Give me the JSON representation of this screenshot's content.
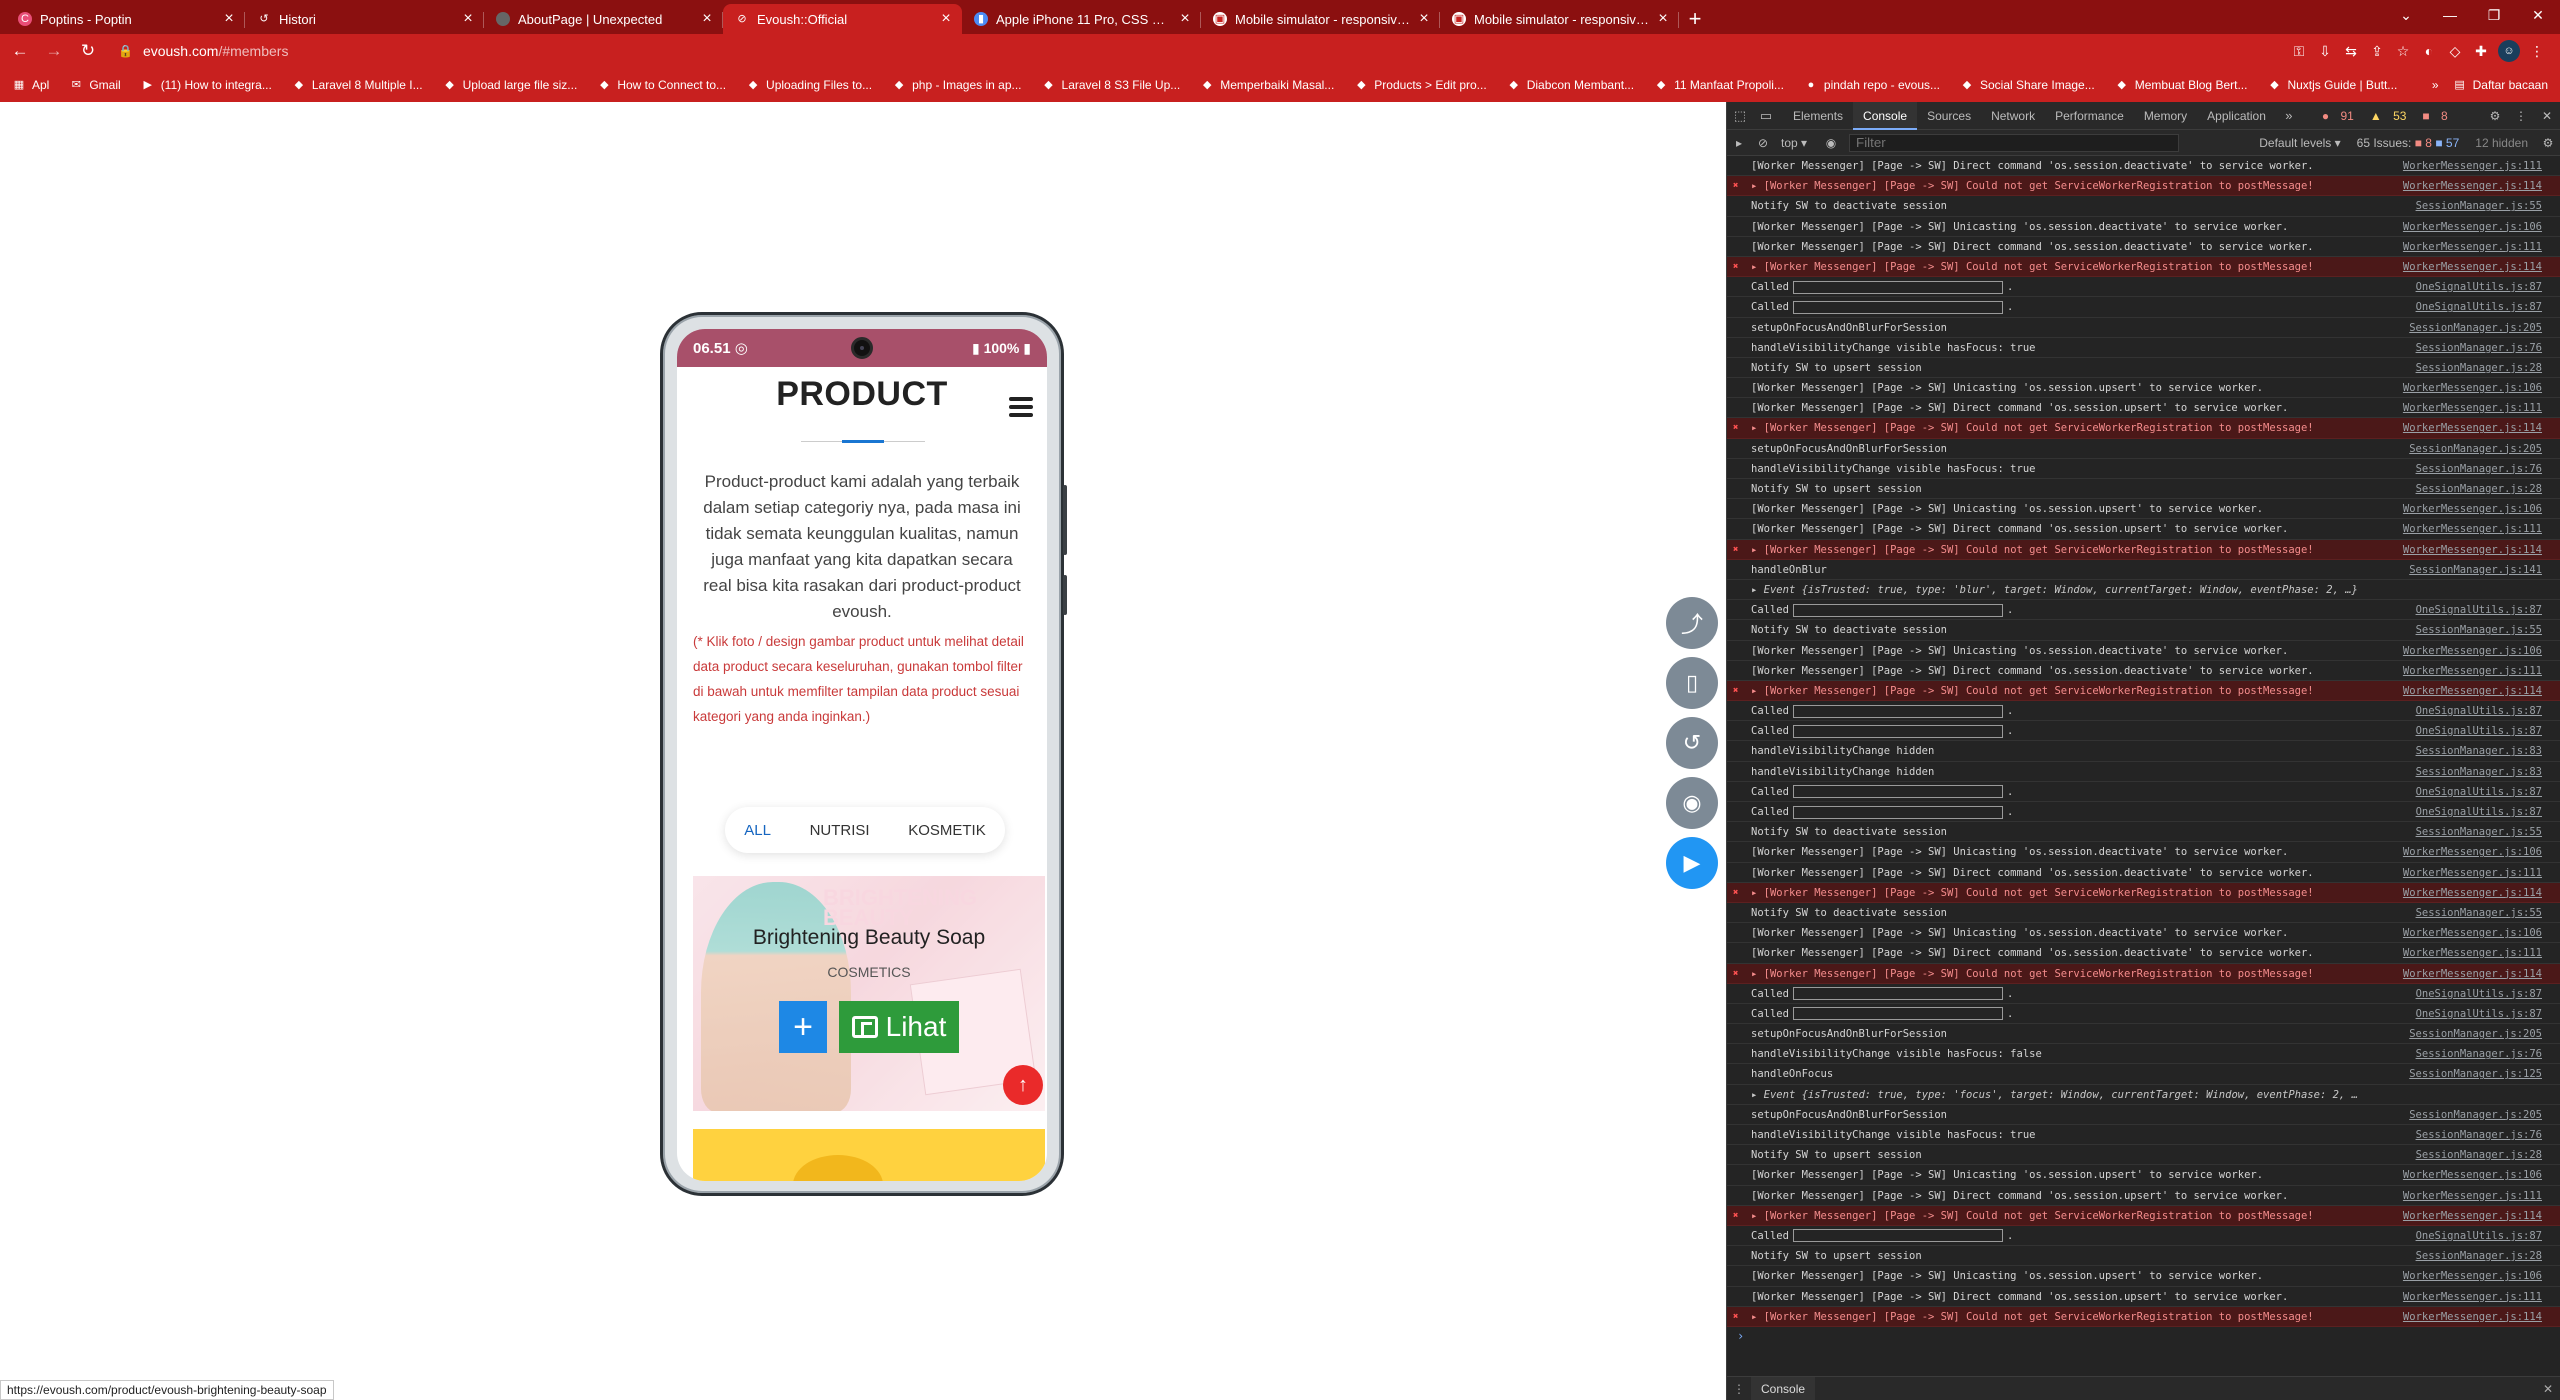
{
  "tabs": [
    {
      "title": "Poptins - Poptin",
      "icon": "poptin-favicon",
      "active": false
    },
    {
      "title": "Histori",
      "icon": "history-icon",
      "active": false
    },
    {
      "title": "AboutPage | Unexpected",
      "icon": "generic-favicon",
      "active": false
    },
    {
      "title": "Evoush::Official",
      "icon": "evoush-favicon",
      "active": true
    },
    {
      "title": "Apple iPhone 11 Pro, CSS viewport",
      "icon": "doc-favicon",
      "active": false
    },
    {
      "title": "Mobile simulator - responsive te",
      "icon": "simulator-favicon",
      "active": false
    },
    {
      "title": "Mobile simulator - responsive te",
      "icon": "simulator-favicon",
      "active": false
    }
  ],
  "address": {
    "domain": "evoush.com",
    "path": "/#members"
  },
  "bookmarks": [
    {
      "label": "Apl",
      "icon": "apps-icon"
    },
    {
      "label": "Gmail",
      "icon": "gmail-icon"
    },
    {
      "label": "(11) How to integra...",
      "icon": "youtube-icon"
    },
    {
      "label": "Laravel 8 Multiple I...",
      "icon": "site-icon"
    },
    {
      "label": "Upload large file siz...",
      "icon": "site-icon"
    },
    {
      "label": "How to Connect to...",
      "icon": "site-icon"
    },
    {
      "label": "Uploading Files to...",
      "icon": "site-icon"
    },
    {
      "label": "php - Images in ap...",
      "icon": "site-icon"
    },
    {
      "label": "Laravel 8 S3 File Up...",
      "icon": "site-icon"
    },
    {
      "label": "Memperbaiki Masal...",
      "icon": "site-icon"
    },
    {
      "label": "Products > Edit pro...",
      "icon": "site-icon"
    },
    {
      "label": "Diabcon Membant...",
      "icon": "site-icon"
    },
    {
      "label": "11 Manfaat Propoli...",
      "icon": "site-icon"
    },
    {
      "label": "pindah repo - evous...",
      "icon": "github-icon"
    },
    {
      "label": "Social Share Image...",
      "icon": "site-icon"
    },
    {
      "label": "Membuat Blog Bert...",
      "icon": "site-icon"
    },
    {
      "label": "Nuxtjs Guide | Butt...",
      "icon": "site-icon"
    }
  ],
  "bookmarks_more": "Daftar bacaan",
  "phone": {
    "time": "06.51",
    "battery": "100%",
    "page_title": "PRODUCT",
    "description": "Product-product kami adalah yang terbaik dalam setiap categoriy nya, pada masa ini tidak semata keunggulan kualitas, namun juga manfaat yang kita dapatkan secara real bisa kita rasakan dari product-product evoush.",
    "note": "(* Klik foto / design gambar product untuk melihat detail data product secara keseluruhan, gunakan tombol filter di bawah untuk memfilter tampilan data product sesuai kategori yang anda inginkan.)",
    "filters": [
      "ALL",
      "NUTRISI",
      "KOSMETIK"
    ],
    "active_filter": "ALL",
    "card": {
      "name": "Brightening Beauty Soap",
      "category": "COSMETICS",
      "plus": "+",
      "view": "Lihat",
      "image_text": "BRIGHTENING BEAUTY"
    }
  },
  "status_url": "https://evoush.com/product/evoush-brightening-beauty-soap",
  "devtools": {
    "tabs": [
      "Elements",
      "Console",
      "Sources",
      "Network",
      "Performance",
      "Memory",
      "Application"
    ],
    "active_tab": "Console",
    "errors": "91",
    "warnings": "53",
    "issues_badge": "8",
    "context": "top",
    "filter_placeholder": "Filter",
    "levels": "Default levels",
    "issues_label": "65 Issues:",
    "issues_err": "8",
    "issues_info": "57",
    "hidden": "12 hidden",
    "drawer_tab": "Console",
    "logs": [
      {
        "t": "log",
        "m": "[Worker Messenger] [Page -> SW] Direct command 'os.session.deactivate' to service worker.",
        "s": "WorkerMessenger.js:111"
      },
      {
        "t": "err",
        "m": "[Worker Messenger] [Page -> SW] Could not get ServiceWorkerRegistration to postMessage!",
        "s": "WorkerMessenger.js:114"
      },
      {
        "t": "log",
        "m": "Notify SW to deactivate session",
        "s": "SessionManager.js:55"
      },
      {
        "t": "log",
        "m": "[Worker Messenger] [Page -> SW] Unicasting 'os.session.deactivate' to service worker.",
        "s": "WorkerMessenger.js:106"
      },
      {
        "t": "log",
        "m": "[Worker Messenger] [Page -> SW] Direct command 'os.session.deactivate' to service worker.",
        "s": "WorkerMessenger.js:111"
      },
      {
        "t": "err",
        "m": "[Worker Messenger] [Page -> SW] Could not get ServiceWorkerRegistration to postMessage!",
        "s": "WorkerMessenger.js:114"
      },
      {
        "t": "called",
        "m": "Called",
        "s": "OneSignalUtils.js:87"
      },
      {
        "t": "called",
        "m": "Called",
        "s": "OneSignalUtils.js:87"
      },
      {
        "t": "log",
        "m": "setupOnFocusAndOnBlurForSession",
        "s": "SessionManager.js:205"
      },
      {
        "t": "log",
        "m": "handleVisibilityChange visible hasFocus: true",
        "s": "SessionManager.js:76"
      },
      {
        "t": "log",
        "m": "Notify SW to upsert session",
        "s": "SessionManager.js:28"
      },
      {
        "t": "log",
        "m": "[Worker Messenger] [Page -> SW] Unicasting 'os.session.upsert' to service worker.",
        "s": "WorkerMessenger.js:106"
      },
      {
        "t": "log",
        "m": "[Worker Messenger] [Page -> SW] Direct command 'os.session.upsert' to service worker.",
        "s": "WorkerMessenger.js:111"
      },
      {
        "t": "err",
        "m": "[Worker Messenger] [Page -> SW] Could not get ServiceWorkerRegistration to postMessage!",
        "s": "WorkerMessenger.js:114"
      },
      {
        "t": "log",
        "m": "setupOnFocusAndOnBlurForSession",
        "s": "SessionManager.js:205"
      },
      {
        "t": "log",
        "m": "handleVisibilityChange visible hasFocus: true",
        "s": "SessionManager.js:76"
      },
      {
        "t": "log",
        "m": "Notify SW to upsert session",
        "s": "SessionManager.js:28"
      },
      {
        "t": "log",
        "m": "[Worker Messenger] [Page -> SW] Unicasting 'os.session.upsert' to service worker.",
        "s": "WorkerMessenger.js:106"
      },
      {
        "t": "log",
        "m": "[Worker Messenger] [Page -> SW] Direct command 'os.session.upsert' to service worker.",
        "s": "WorkerMessenger.js:111"
      },
      {
        "t": "err",
        "m": "[Worker Messenger] [Page -> SW] Could not get ServiceWorkerRegistration to postMessage!",
        "s": "WorkerMessenger.js:114"
      },
      {
        "t": "log",
        "m": "handleOnBlur",
        "s": "SessionManager.js:141"
      },
      {
        "t": "event",
        "m": "Event {isTrusted: true, type: 'blur', target: Window, currentTarget: Window, eventPhase: 2, …}",
        "s": ""
      },
      {
        "t": "called",
        "m": "Called",
        "s": "OneSignalUtils.js:87"
      },
      {
        "t": "log",
        "m": "Notify SW to deactivate session",
        "s": "SessionManager.js:55"
      },
      {
        "t": "log",
        "m": "[Worker Messenger] [Page -> SW] Unicasting 'os.session.deactivate' to service worker.",
        "s": "WorkerMessenger.js:106"
      },
      {
        "t": "log",
        "m": "[Worker Messenger] [Page -> SW] Direct command 'os.session.deactivate' to service worker.",
        "s": "WorkerMessenger.js:111"
      },
      {
        "t": "err",
        "m": "[Worker Messenger] [Page -> SW] Could not get ServiceWorkerRegistration to postMessage!",
        "s": "WorkerMessenger.js:114"
      },
      {
        "t": "called",
        "m": "Called",
        "s": "OneSignalUtils.js:87"
      },
      {
        "t": "called",
        "m": "Called",
        "s": "OneSignalUtils.js:87"
      },
      {
        "t": "log",
        "m": "handleVisibilityChange hidden",
        "s": "SessionManager.js:83"
      },
      {
        "t": "log",
        "m": "handleVisibilityChange hidden",
        "s": "SessionManager.js:83"
      },
      {
        "t": "called",
        "m": "Called",
        "s": "OneSignalUtils.js:87"
      },
      {
        "t": "called",
        "m": "Called",
        "s": "OneSignalUtils.js:87"
      },
      {
        "t": "log",
        "m": "Notify SW to deactivate session",
        "s": "SessionManager.js:55"
      },
      {
        "t": "log",
        "m": "[Worker Messenger] [Page -> SW] Unicasting 'os.session.deactivate' to service worker.",
        "s": "WorkerMessenger.js:106"
      },
      {
        "t": "log",
        "m": "[Worker Messenger] [Page -> SW] Direct command 'os.session.deactivate' to service worker.",
        "s": "WorkerMessenger.js:111"
      },
      {
        "t": "err",
        "m": "[Worker Messenger] [Page -> SW] Could not get ServiceWorkerRegistration to postMessage!",
        "s": "WorkerMessenger.js:114"
      },
      {
        "t": "log",
        "m": "Notify SW to deactivate session",
        "s": "SessionManager.js:55"
      },
      {
        "t": "log",
        "m": "[Worker Messenger] [Page -> SW] Unicasting 'os.session.deactivate' to service worker.",
        "s": "WorkerMessenger.js:106"
      },
      {
        "t": "log",
        "m": "[Worker Messenger] [Page -> SW] Direct command 'os.session.deactivate' to service worker.",
        "s": "WorkerMessenger.js:111"
      },
      {
        "t": "err",
        "m": "[Worker Messenger] [Page -> SW] Could not get ServiceWorkerRegistration to postMessage!",
        "s": "WorkerMessenger.js:114"
      },
      {
        "t": "called",
        "m": "Called",
        "s": "OneSignalUtils.js:87"
      },
      {
        "t": "called",
        "m": "Called",
        "s": "OneSignalUtils.js:87"
      },
      {
        "t": "log",
        "m": "setupOnFocusAndOnBlurForSession",
        "s": "SessionManager.js:205"
      },
      {
        "t": "log",
        "m": "handleVisibilityChange visible hasFocus: false",
        "s": "SessionManager.js:76"
      },
      {
        "t": "log",
        "m": "handleOnFocus",
        "s": "SessionManager.js:125"
      },
      {
        "t": "event",
        "m": "Event {isTrusted: true, type: 'focus', target: Window, currentTarget: Window, eventPhase: 2, …}",
        "s": ""
      },
      {
        "t": "log",
        "m": "setupOnFocusAndOnBlurForSession",
        "s": "SessionManager.js:205"
      },
      {
        "t": "log",
        "m": "handleVisibilityChange visible hasFocus: true",
        "s": "SessionManager.js:76"
      },
      {
        "t": "log",
        "m": "Notify SW to upsert session",
        "s": "SessionManager.js:28"
      },
      {
        "t": "log",
        "m": "[Worker Messenger] [Page -> SW] Unicasting 'os.session.upsert' to service worker.",
        "s": "WorkerMessenger.js:106"
      },
      {
        "t": "log",
        "m": "[Worker Messenger] [Page -> SW] Direct command 'os.session.upsert' to service worker.",
        "s": "WorkerMessenger.js:111"
      },
      {
        "t": "err",
        "m": "[Worker Messenger] [Page -> SW] Could not get ServiceWorkerRegistration to postMessage!",
        "s": "WorkerMessenger.js:114"
      },
      {
        "t": "called",
        "m": "Called",
        "s": "OneSignalUtils.js:87"
      },
      {
        "t": "log",
        "m": "Notify SW to upsert session",
        "s": "SessionManager.js:28"
      },
      {
        "t": "log",
        "m": "[Worker Messenger] [Page -> SW] Unicasting 'os.session.upsert' to service worker.",
        "s": "WorkerMessenger.js:106"
      },
      {
        "t": "log",
        "m": "[Worker Messenger] [Page -> SW] Direct command 'os.session.upsert' to service worker.",
        "s": "WorkerMessenger.js:111"
      },
      {
        "t": "err",
        "m": "[Worker Messenger] [Page -> SW] Could not get ServiceWorkerRegistration to postMessage!",
        "s": "WorkerMessenger.js:114"
      }
    ]
  }
}
